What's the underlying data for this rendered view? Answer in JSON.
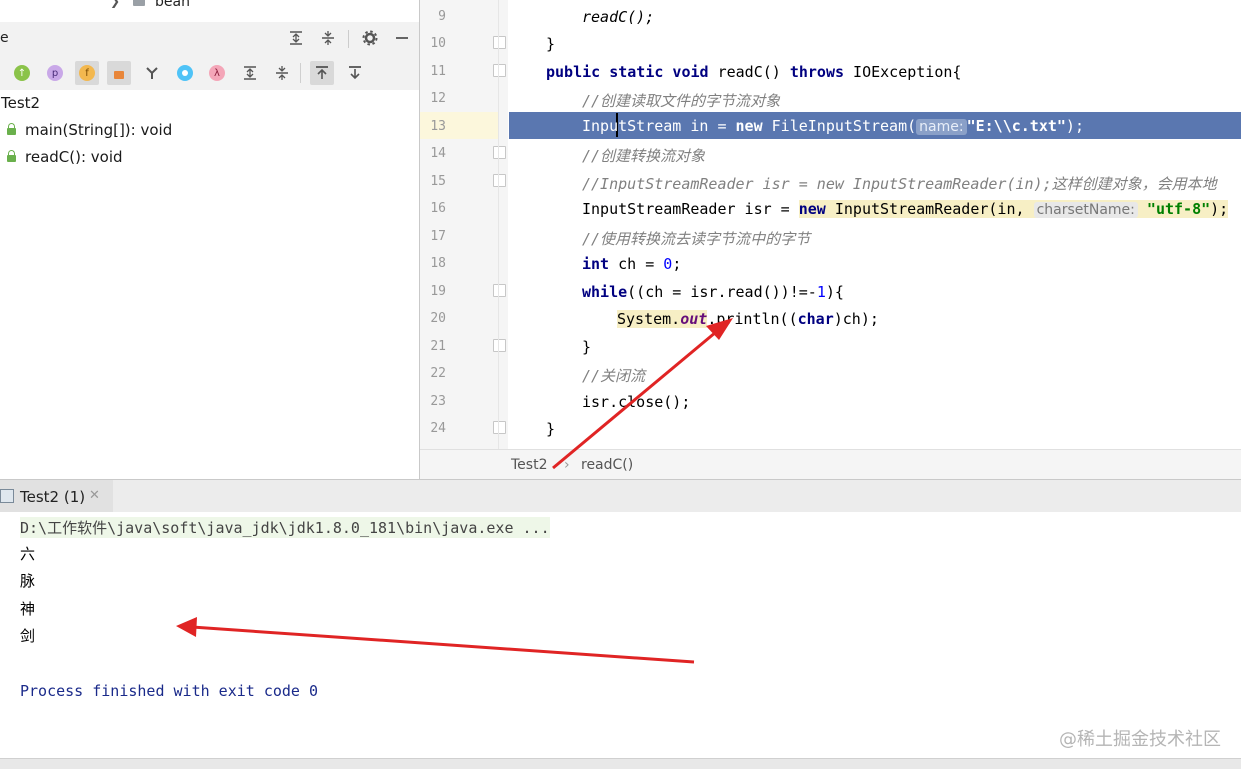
{
  "project_tree": {
    "visible_item": "bean"
  },
  "structure": {
    "title": "e",
    "toolbar_icons": [
      "inherited-icon",
      "property-icon",
      "field-icon",
      "lock-icon",
      "hierarchy-icon",
      "circle-icon",
      "lambda-icon",
      "expand-all-icon",
      "collapse-all-icon",
      "autoscroll-to-source-icon",
      "autoscroll-from-source-icon"
    ],
    "class_name": "Test2",
    "members": [
      "main(String[]): void",
      "readC(): void"
    ]
  },
  "editor": {
    "lines": [
      {
        "n": "9"
      },
      {
        "n": "10"
      },
      {
        "n": "11"
      },
      {
        "n": "12"
      },
      {
        "n": "13"
      },
      {
        "n": "14"
      },
      {
        "n": "15"
      },
      {
        "n": "16"
      },
      {
        "n": "17"
      },
      {
        "n": "18"
      },
      {
        "n": "19"
      },
      {
        "n": "20"
      },
      {
        "n": "21"
      },
      {
        "n": "22"
      },
      {
        "n": "23"
      },
      {
        "n": "24"
      }
    ],
    "code": {
      "l9": "readC();",
      "l10": "}",
      "l11_kw": "public static void",
      "l11_rest": " readC() ",
      "l11_throws": "throws",
      "l11_end": " IOException{",
      "l12": "//创建读取文件的字节流对象",
      "l13_a": "InputStream in = ",
      "l13_new": "new",
      "l13_b": " FileInputStream(",
      "l13_hint": "name:",
      "l13_str": "\"E:\\\\c.txt\"",
      "l13_end": ");",
      "l14": "//创建转换流对象",
      "l15": "//InputStreamReader isr = new InputStreamReader(in);这样创建对象，会用本地",
      "l16_a": "InputStreamReader isr = ",
      "l16_new": "new",
      "l16_b": " InputStreamReader(in, ",
      "l16_hint": "charsetName:",
      "l16_str": "\"utf-8\"",
      "l16_end": ");",
      "l17": "//使用转换流去读字节流中的字节",
      "l18_kw": "int",
      "l18_a": " ch = ",
      "l18_num": "0",
      "l18_end": ";",
      "l19_kw": "while",
      "l19_a": "((ch = isr.read())!=-",
      "l19_num": "1",
      "l19_end": "){",
      "l20_a": "System.",
      "l20_out": "out",
      "l20_b": ".println((",
      "l20_char": "char",
      "l20_end": ")ch);",
      "l21": "}",
      "l22": "//关闭流",
      "l23": "isr.close();",
      "l24": "}"
    }
  },
  "breadcrumb": {
    "items": [
      "Test2",
      "readC()"
    ],
    "separator": "›"
  },
  "run": {
    "tab_label": "Test2 (1)",
    "command": "D:\\工作软件\\java\\soft\\java_jdk\\jdk1.8.0_181\\bin\\java.exe ...",
    "output": [
      "六",
      "脉",
      "神",
      "剑"
    ],
    "finish": "Process finished with exit code 0"
  },
  "watermark": "@稀土掘金技术社区",
  "colors": {
    "selection": "#5a77b0",
    "keyword": "#000080",
    "comment": "#808080",
    "string": "#008000",
    "annotation_arrow": "#e02424"
  }
}
